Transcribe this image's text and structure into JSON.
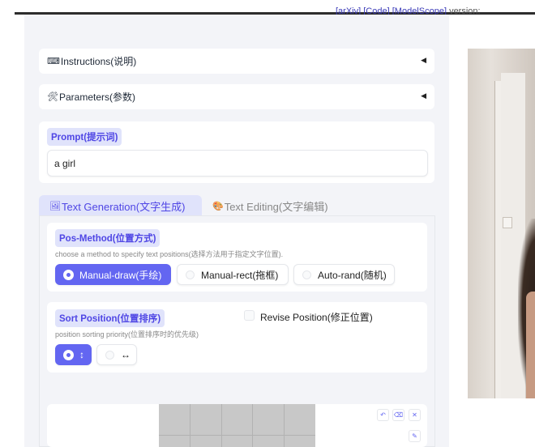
{
  "header": {
    "links": [
      "[arXiv]",
      "[Code]",
      "[ModelScope]"
    ],
    "version_text": " version: "
  },
  "accordions": {
    "instructions": {
      "icon": "⌨",
      "label": "Instructions(说明)",
      "arrow": "◀"
    },
    "parameters": {
      "icon": "🛠",
      "label": "Parameters(参数)",
      "arrow": "◀"
    }
  },
  "prompt": {
    "label": "Prompt(提示词)",
    "value": "a girl"
  },
  "tabs": [
    {
      "icon": "🖼",
      "label": "Text Generation(文字生成)",
      "active": true
    },
    {
      "icon": "🎨",
      "label": "Text Editing(文字编辑)",
      "active": false
    }
  ],
  "pos_method": {
    "label": "Pos-Method(位置方式)",
    "description": "choose a method to specify text positions(选择方法用于指定文字位置).",
    "options": [
      "Manual-draw(手绘)",
      "Manual-rect(拖框)",
      "Auto-rand(随机)"
    ],
    "selected": "Manual-draw(手绘)"
  },
  "sort_position": {
    "label": "Sort Position(位置排序)",
    "description": "position sorting priority(位置排序时的优先级)",
    "options": [
      "↕",
      "↔"
    ],
    "selected": "↕"
  },
  "revise_position": {
    "label": "Revise Position(修正位置)",
    "checked": false
  },
  "sketch_tools": {
    "undo": "↶",
    "erase": "⌫",
    "clear": "✕",
    "brush": "✎"
  },
  "colors": {
    "accent": "#6366f1",
    "chip_bg": "#e0e3fb",
    "chip_text": "#4f46e5",
    "panel_bg": "#f3f4f8"
  }
}
